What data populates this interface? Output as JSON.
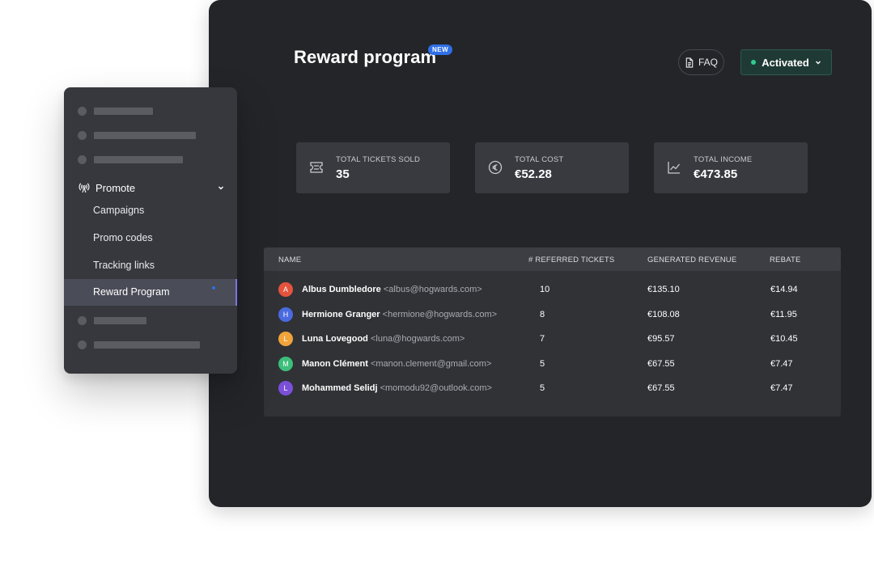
{
  "header": {
    "title": "Reward program",
    "badge": "NEW",
    "faq_label": "FAQ",
    "status_label": "Activated"
  },
  "stats": [
    {
      "label": "TOTAL TICKETS SOLD",
      "value": "35",
      "icon": "ticket-icon"
    },
    {
      "label": "TOTAL COST",
      "value": "€52.28",
      "icon": "euro-icon"
    },
    {
      "label": "TOTAL INCOME",
      "value": "€473.85",
      "icon": "line-chart-icon"
    }
  ],
  "table": {
    "columns": [
      "NAME",
      "# REFERRED TICKETS",
      "GENERATED REVENUE",
      "REBATE"
    ],
    "rows": [
      {
        "initial": "A",
        "name": "Albus Dumbledore",
        "email": "<albus@hogwards.com>",
        "tickets": "10",
        "revenue": "€135.10",
        "rebate": "€14.94",
        "color": "#e5533d"
      },
      {
        "initial": "H",
        "name": "Hermione Granger",
        "email": "<hermione@hogwards.com>",
        "tickets": "8",
        "revenue": "€108.08",
        "rebate": "€11.95",
        "color": "#4a6ae0"
      },
      {
        "initial": "L",
        "name": "Luna Lovegood",
        "email": "<luna@hogwards.com>",
        "tickets": "7",
        "revenue": "€95.57",
        "rebate": "€10.45",
        "color": "#f0a43a"
      },
      {
        "initial": "M",
        "name": "Manon Clément",
        "email": "<manon.clement@gmail.com>",
        "tickets": "5",
        "revenue": "€67.55",
        "rebate": "€7.47",
        "color": "#3cbf7a"
      },
      {
        "initial": "L",
        "name": "Mohammed Selidj",
        "email": "<momodu92@outlook.com>",
        "tickets": "5",
        "revenue": "€67.55",
        "rebate": "€7.47",
        "color": "#7b4fd8"
      }
    ]
  },
  "sidebar": {
    "section_label": "Promote",
    "items": [
      "Campaigns",
      "Promo codes",
      "Tracking links",
      "Reward Program"
    ],
    "active_item": "Reward Program"
  },
  "colors": {
    "panel_bg": "#232529",
    "sidebar_bg": "#36383d",
    "accent": "#2f6fe8",
    "status_green": "#2ecc8f",
    "active_border": "#7d74e6"
  }
}
